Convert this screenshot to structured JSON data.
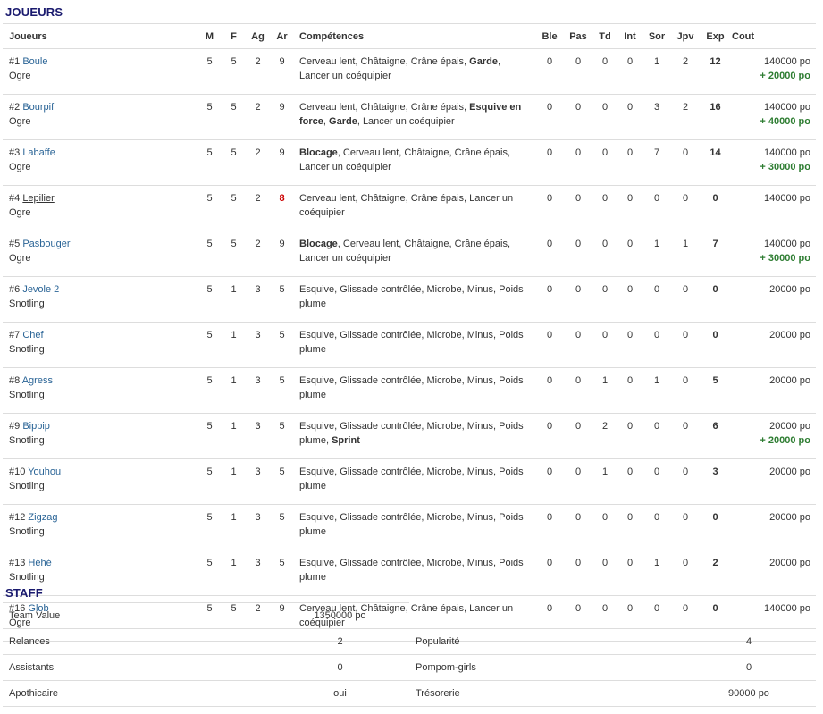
{
  "joueurs_title": "JOUEURS",
  "staff_title": "STAFF",
  "headers": [
    "Joueurs",
    "M",
    "F",
    "Ag",
    "Ar",
    "Compétences",
    "Ble",
    "Pas",
    "Td",
    "Int",
    "Sor",
    "Jpv",
    "Exp",
    "Cout"
  ],
  "players": [
    {
      "num": "#1",
      "name": "Boule",
      "race": "Ogre",
      "m": "5",
      "f": "5",
      "ag": "2",
      "ar": "9",
      "skills": [
        {
          "t": "Cerveau lent, Châtaigne, Crâne épais, "
        },
        {
          "t": "Garde",
          "b": true
        },
        {
          "t": ", Lancer un coéquipier"
        }
      ],
      "ble": "0",
      "pas": "0",
      "td": "0",
      "int": "0",
      "sor": "1",
      "jpv": "2",
      "exp": "12",
      "cost": "140000 po",
      "bonus": "+ 20000 po"
    },
    {
      "num": "#2",
      "name": "Bourpif",
      "race": "Ogre",
      "m": "5",
      "f": "5",
      "ag": "2",
      "ar": "9",
      "skills": [
        {
          "t": "Cerveau lent, Châtaigne, Crâne épais, "
        },
        {
          "t": "Esquive en force",
          "b": true
        },
        {
          "t": ", "
        },
        {
          "t": "Garde",
          "b": true
        },
        {
          "t": ", Lancer un coéquipier"
        }
      ],
      "ble": "0",
      "pas": "0",
      "td": "0",
      "int": "0",
      "sor": "3",
      "jpv": "2",
      "exp": "16",
      "cost": "140000 po",
      "bonus": "+ 40000 po"
    },
    {
      "num": "#3",
      "name": "Labaffe",
      "race": "Ogre",
      "m": "5",
      "f": "5",
      "ag": "2",
      "ar": "9",
      "skills": [
        {
          "t": "Blocage",
          "b": true
        },
        {
          "t": ", Cerveau lent, Châtaigne, Crâne épais, Lancer un coéquipier"
        }
      ],
      "ble": "0",
      "pas": "0",
      "td": "0",
      "int": "0",
      "sor": "7",
      "jpv": "0",
      "exp": "14",
      "cost": "140000 po",
      "bonus": "+ 30000 po"
    },
    {
      "num": "#4",
      "name": "Lepilier",
      "race": "Ogre",
      "m": "5",
      "f": "5",
      "ag": "2",
      "ar": "8",
      "arRed": true,
      "underline": true,
      "skills": [
        {
          "t": "Cerveau lent, Châtaigne, Crâne épais, Lancer un coéquipier"
        }
      ],
      "ble": "0",
      "pas": "0",
      "td": "0",
      "int": "0",
      "sor": "0",
      "jpv": "0",
      "exp": "0",
      "cost": "140000 po",
      "bonus": ""
    },
    {
      "num": "#5",
      "name": "Pasbouger",
      "race": "Ogre",
      "m": "5",
      "f": "5",
      "ag": "2",
      "ar": "9",
      "skills": [
        {
          "t": "Blocage",
          "b": true
        },
        {
          "t": ", Cerveau lent, Châtaigne, Crâne épais, Lancer un coéquipier"
        }
      ],
      "ble": "0",
      "pas": "0",
      "td": "0",
      "int": "0",
      "sor": "1",
      "jpv": "1",
      "exp": "7",
      "cost": "140000 po",
      "bonus": "+ 30000 po"
    },
    {
      "num": "#6",
      "name": "Jevole 2",
      "race": "Snotling",
      "m": "5",
      "f": "1",
      "ag": "3",
      "ar": "5",
      "skills": [
        {
          "t": "Esquive, Glissade contrôlée, Microbe, Minus, Poids plume"
        }
      ],
      "ble": "0",
      "pas": "0",
      "td": "0",
      "int": "0",
      "sor": "0",
      "jpv": "0",
      "exp": "0",
      "cost": "20000 po",
      "bonus": ""
    },
    {
      "num": "#7",
      "name": "Chef",
      "race": "Snotling",
      "m": "5",
      "f": "1",
      "ag": "3",
      "ar": "5",
      "skills": [
        {
          "t": "Esquive, Glissade contrôlée, Microbe, Minus, Poids plume"
        }
      ],
      "ble": "0",
      "pas": "0",
      "td": "0",
      "int": "0",
      "sor": "0",
      "jpv": "0",
      "exp": "0",
      "cost": "20000 po",
      "bonus": ""
    },
    {
      "num": "#8",
      "name": "Agress",
      "race": "Snotling",
      "m": "5",
      "f": "1",
      "ag": "3",
      "ar": "5",
      "skills": [
        {
          "t": "Esquive, Glissade contrôlée, Microbe, Minus, Poids plume"
        }
      ],
      "ble": "0",
      "pas": "0",
      "td": "1",
      "int": "0",
      "sor": "1",
      "jpv": "0",
      "exp": "5",
      "cost": "20000 po",
      "bonus": ""
    },
    {
      "num": "#9",
      "name": "Bipbip",
      "race": "Snotling",
      "m": "5",
      "f": "1",
      "ag": "3",
      "ar": "5",
      "skills": [
        {
          "t": "Esquive, Glissade contrôlée, Microbe, Minus, Poids plume, "
        },
        {
          "t": "Sprint",
          "b": true
        }
      ],
      "ble": "0",
      "pas": "0",
      "td": "2",
      "int": "0",
      "sor": "0",
      "jpv": "0",
      "exp": "6",
      "cost": "20000 po",
      "bonus": "+ 20000 po"
    },
    {
      "num": "#10",
      "name": "Youhou",
      "race": "Snotling",
      "m": "5",
      "f": "1",
      "ag": "3",
      "ar": "5",
      "skills": [
        {
          "t": "Esquive, Glissade contrôlée, Microbe, Minus, Poids plume"
        }
      ],
      "ble": "0",
      "pas": "0",
      "td": "1",
      "int": "0",
      "sor": "0",
      "jpv": "0",
      "exp": "3",
      "cost": "20000 po",
      "bonus": ""
    },
    {
      "num": "#12",
      "name": "Zigzag",
      "race": "Snotling",
      "m": "5",
      "f": "1",
      "ag": "3",
      "ar": "5",
      "skills": [
        {
          "t": "Esquive, Glissade contrôlée, Microbe, Minus, Poids plume"
        }
      ],
      "ble": "0",
      "pas": "0",
      "td": "0",
      "int": "0",
      "sor": "0",
      "jpv": "0",
      "exp": "0",
      "cost": "20000 po",
      "bonus": ""
    },
    {
      "num": "#13",
      "name": "Héhé",
      "race": "Snotling",
      "m": "5",
      "f": "1",
      "ag": "3",
      "ar": "5",
      "skills": [
        {
          "t": "Esquive, Glissade contrôlée, Microbe, Minus, Poids plume"
        }
      ],
      "ble": "0",
      "pas": "0",
      "td": "0",
      "int": "0",
      "sor": "1",
      "jpv": "0",
      "exp": "2",
      "cost": "20000 po",
      "bonus": ""
    },
    {
      "num": "#16",
      "name": "Glob",
      "race": "Ogre",
      "m": "5",
      "f": "5",
      "ag": "2",
      "ar": "9",
      "skills": [
        {
          "t": "Cerveau lent, Châtaigne, Crâne épais, Lancer un coéquipier"
        }
      ],
      "ble": "0",
      "pas": "0",
      "td": "0",
      "int": "0",
      "sor": "0",
      "jpv": "0",
      "exp": "0",
      "cost": "140000 po",
      "bonus": ""
    }
  ],
  "staff": {
    "team_value_label": "Team Value",
    "team_value": "1350000 po",
    "rows": [
      {
        "l1": "Relances",
        "v1": "2",
        "l2": "Popularité",
        "v2": "4"
      },
      {
        "l1": "Assistants",
        "v1": "0",
        "l2": "Pompom-girls",
        "v2": "0"
      },
      {
        "l1": "Apothicaire",
        "v1": "oui",
        "l2": "Trésorerie",
        "v2": "90000 po"
      }
    ]
  },
  "colors": {
    "title": "#1a1a6e",
    "link": "#2a6496",
    "bonus": "#2e7d32",
    "injury": "#cc0000",
    "border": "#dddddd"
  }
}
